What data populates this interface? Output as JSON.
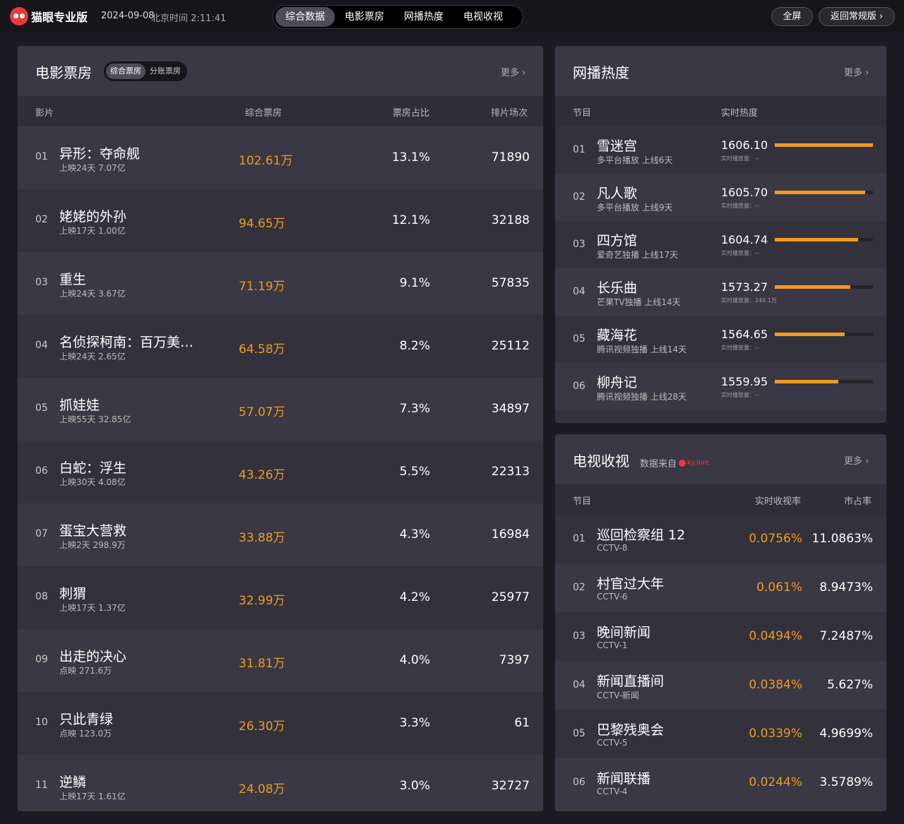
{
  "header": {
    "logo_text": "猫眼专业版",
    "date": "2024-09-08",
    "time": "北京时间 2:11:41",
    "tabs": [
      "综合数据",
      "电影票房",
      "网播热度",
      "电视收视"
    ],
    "fullscreen": "全屏",
    "back": "返回常规版"
  },
  "movie": {
    "title": "电影票房",
    "sub_tabs": [
      "综合票房",
      "分账票房"
    ],
    "more": "更多",
    "columns": [
      "影片",
      "综合票房",
      "票房占比",
      "排片场次"
    ],
    "rows": [
      {
        "rank": "01",
        "name": "异形：夺命舰",
        "sub": "上映24天  7.07亿",
        "box": "102.61万",
        "share": "13.1%",
        "shows": "71890"
      },
      {
        "rank": "02",
        "name": "姥姥的外孙",
        "sub": "上映17天  1.00亿",
        "box": "94.65万",
        "share": "12.1%",
        "shows": "32188"
      },
      {
        "rank": "03",
        "name": "重生",
        "sub": "上映24天  3.67亿",
        "box": "71.19万",
        "share": "9.1%",
        "shows": "57835"
      },
      {
        "rank": "04",
        "name": "名侦探柯南：百万美…",
        "sub": "上映24天  2.65亿",
        "box": "64.58万",
        "share": "8.2%",
        "shows": "25112"
      },
      {
        "rank": "05",
        "name": "抓娃娃",
        "sub": "上映55天  32.85亿",
        "box": "57.07万",
        "share": "7.3%",
        "shows": "34897"
      },
      {
        "rank": "06",
        "name": "白蛇：浮生",
        "sub": "上映30天  4.08亿",
        "box": "43.26万",
        "share": "5.5%",
        "shows": "22313"
      },
      {
        "rank": "07",
        "name": "蛋宝大营救",
        "sub": "上映2天  298.9万",
        "box": "33.88万",
        "share": "4.3%",
        "shows": "16984"
      },
      {
        "rank": "08",
        "name": "刺猬",
        "sub": "上映17天  1.37亿",
        "box": "32.99万",
        "share": "4.2%",
        "shows": "25977"
      },
      {
        "rank": "09",
        "name": "出走的决心",
        "sub": "点映  271.6万",
        "box": "31.81万",
        "share": "4.0%",
        "shows": "7397"
      },
      {
        "rank": "10",
        "name": "只此青绿",
        "sub": "点映  123.0万",
        "box": "26.30万",
        "share": "3.3%",
        "shows": "61"
      },
      {
        "rank": "11",
        "name": "逆鳞",
        "sub": "上映17天  1.61亿",
        "box": "24.08万",
        "share": "3.0%",
        "shows": "32727"
      }
    ]
  },
  "web": {
    "title": "网播热度",
    "more": "更多",
    "columns": [
      "节目",
      "实时热度"
    ],
    "rows": [
      {
        "rank": "01",
        "name": "雪迷宫",
        "sub": "多平台播放  上线6天",
        "heat": "1606.10",
        "plays": "实时播放量：--",
        "fill": 1.0
      },
      {
        "rank": "02",
        "name": "凡人歌",
        "sub": "多平台播放  上线9天",
        "heat": "1605.70",
        "plays": "实时播放量：--",
        "fill": 0.92
      },
      {
        "rank": "03",
        "name": "四方馆",
        "sub": "爱奇艺独播  上线17天",
        "heat": "1604.74",
        "plays": "实时播放量：--",
        "fill": 0.85
      },
      {
        "rank": "04",
        "name": "长乐曲",
        "sub": "芒果TV独播  上线14天",
        "heat": "1573.27",
        "plays": "实时播放量：246.1万",
        "fill": 0.77
      },
      {
        "rank": "05",
        "name": "藏海花",
        "sub": "腾讯视频独播  上线14天",
        "heat": "1564.65",
        "plays": "实时播放量：--",
        "fill": 0.71
      },
      {
        "rank": "06",
        "name": "柳舟记",
        "sub": "腾讯视频独播  上线28天",
        "heat": "1559.95",
        "plays": "实时播放量：--",
        "fill": 0.65
      }
    ]
  },
  "tv": {
    "title": "电视收视",
    "source_label": "数据来自",
    "source_brand": "ky.live",
    "more": "更多",
    "columns": [
      "节目",
      "实时收视率",
      "市占率"
    ],
    "rows": [
      {
        "rank": "01",
        "name": "巡回检察组 12",
        "channel": "CCTV-8",
        "rating": "0.0756%",
        "share": "11.0863%"
      },
      {
        "rank": "02",
        "name": "村官过大年",
        "channel": "CCTV-6",
        "rating": "0.061%",
        "share": "8.9473%"
      },
      {
        "rank": "03",
        "name": "晚间新闻",
        "channel": "CCTV-1",
        "rating": "0.0494%",
        "share": "7.2487%"
      },
      {
        "rank": "04",
        "name": "新闻直播间",
        "channel": "CCTV-新闻",
        "rating": "0.0384%",
        "share": "5.627%"
      },
      {
        "rank": "05",
        "name": "巴黎残奥会",
        "channel": "CCTV-5",
        "rating": "0.0339%",
        "share": "4.9699%"
      },
      {
        "rank": "06",
        "name": "新闻联播",
        "channel": "CCTV-4",
        "rating": "0.0244%",
        "share": "3.5789%"
      }
    ]
  }
}
